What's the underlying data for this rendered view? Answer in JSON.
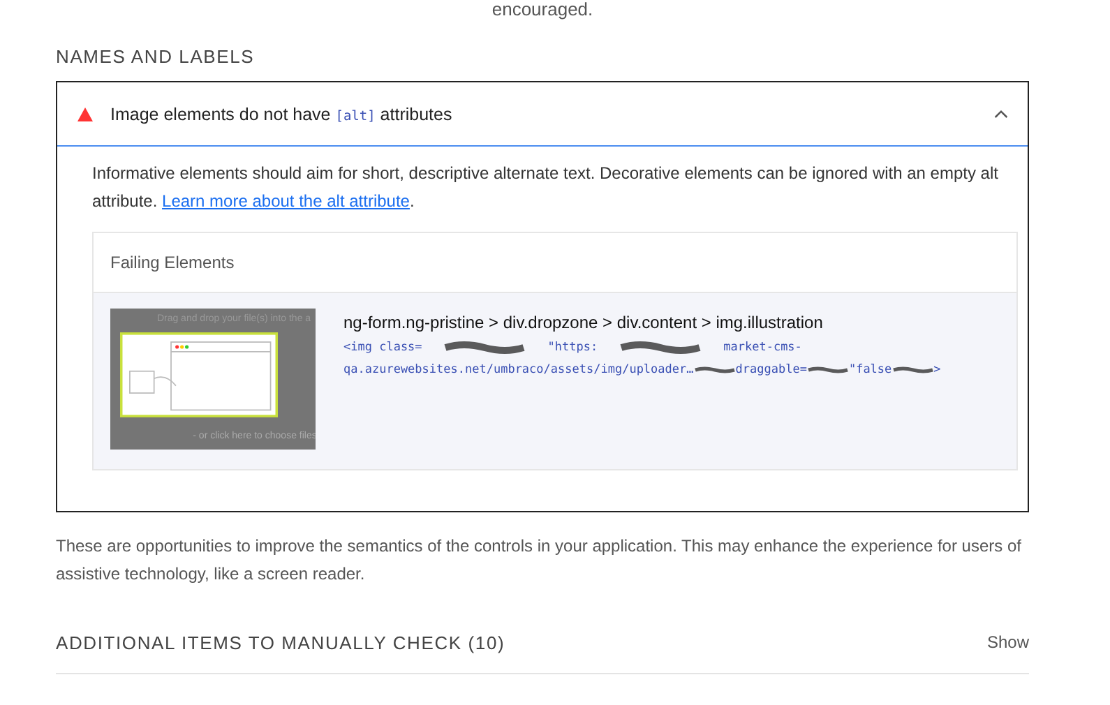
{
  "top_text": "encouraged.",
  "section": {
    "title": "NAMES AND LABELS"
  },
  "audit": {
    "kind": "fail",
    "title_before": "Image elements do not have",
    "title_code": "[alt]",
    "title_after": "attributes",
    "expanded": true,
    "description": "Informative elements should aim for short, descriptive alternate text. Decorative elements can be ignored with an empty alt attribute.",
    "link": "Learn more about the alt attribute",
    "link_end": ".",
    "table": {
      "heading": "Failing Elements",
      "rows": [
        {
          "thumb_top": "Drag and drop your file(s) into the a",
          "thumb_bottom": "- or click here to choose files",
          "selector": "ng-form.ng-pristine > div.dropzone > div.content > img.illustration",
          "snippet_line1": [
            "<img class=",
            "\"https:",
            "market-cms-"
          ],
          "snippet_line2": [
            "qa.azurewebsites.net/umbraco/assets/img/uploader…",
            "draggable=",
            "\"false",
            ">"
          ]
        }
      ]
    }
  },
  "summary": "These are opportunities to improve the semantics of the controls in your application. This may enhance the experience for users of assistive technology, like a screen reader.",
  "manual": {
    "title": "ADDITIONAL ITEMS TO MANUALLY CHECK (10)",
    "toggle": "Show"
  }
}
